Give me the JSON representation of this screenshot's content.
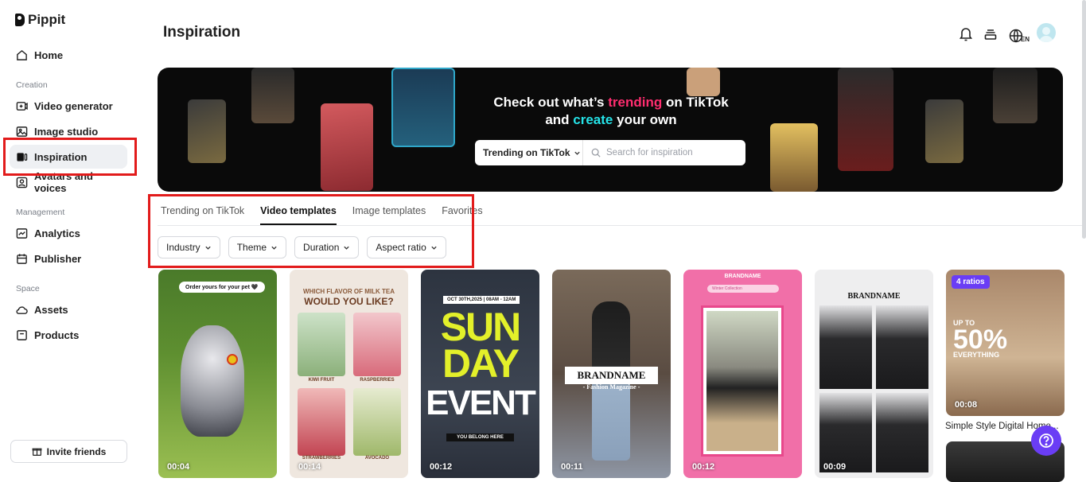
{
  "app": {
    "name": "Pippit"
  },
  "sidebar": {
    "home": "Home",
    "sections": {
      "creation": "Creation",
      "management": "Management",
      "space": "Space"
    },
    "items": [
      {
        "label": "Video generator",
        "icon": "video-plus-icon"
      },
      {
        "label": "Image studio",
        "icon": "image-icon"
      },
      {
        "label": "Inspiration",
        "icon": "inspiration-icon",
        "active": true
      },
      {
        "label": "Avatars and voices",
        "icon": "avatar-icon"
      },
      {
        "label": "Analytics",
        "icon": "chart-icon"
      },
      {
        "label": "Publisher",
        "icon": "calendar-icon"
      },
      {
        "label": "Assets",
        "icon": "cloud-icon"
      },
      {
        "label": "Products",
        "icon": "box-icon"
      }
    ],
    "invite": "Invite friends"
  },
  "header": {
    "title": "Inspiration",
    "lang": "EN",
    "icons": [
      "bell-icon",
      "stack-icon",
      "globe-icon",
      "avatar-icon"
    ]
  },
  "banner": {
    "line1_a": "Check out what’s ",
    "line1_b": "trending",
    "line1_c": " on TikTok",
    "line2_a": "and ",
    "line2_b": "create",
    "line2_c": " your own",
    "dropdown": "Trending on TikTok",
    "search_placeholder": "Search for inspiration"
  },
  "tabs": [
    "Trending on TikTok",
    "Video templates",
    "Image templates",
    "Favorites"
  ],
  "active_tab": "Video templates",
  "filters": [
    "Industry",
    "Theme",
    "Duration",
    "Aspect ratio"
  ],
  "cards": [
    {
      "duration": "00:04",
      "text": "Order yours for your pet 🖤"
    },
    {
      "duration": "00:14",
      "text": "WHICH FLAVOR OF MILK TEA",
      "text2": "WOULD YOU LIKE?",
      "labels": [
        "KIWI FRUIT",
        "RASPBERRIES",
        "STRAWBERRIES",
        "AVOCADO"
      ]
    },
    {
      "duration": "00:12",
      "text": "OCT 30TH,2025 | 08AM - 12AM",
      "big1": "SUN",
      "big2": "DAY",
      "big3": "EVENT",
      "text2": "YOU BELONG HERE"
    },
    {
      "duration": "00:11",
      "text": "BRANDNAME",
      "text2": "- Fashion Magazine -"
    },
    {
      "duration": "00:12",
      "text": "BRANDNAME",
      "text2": "Winter Collection"
    },
    {
      "duration": "00:09",
      "text": "BRANDNAME"
    },
    {
      "duration": "00:08",
      "ratio": "4 ratios",
      "text": "UP TO",
      "big": "50%",
      "text2": "EVERYTHING",
      "caption": "Simple Style Digital Home..."
    }
  ],
  "colors": {
    "accent": "#6a3df5",
    "highlight": "#e21b1b",
    "pink": "#ff2d6f",
    "cyan": "#25e3e8"
  }
}
